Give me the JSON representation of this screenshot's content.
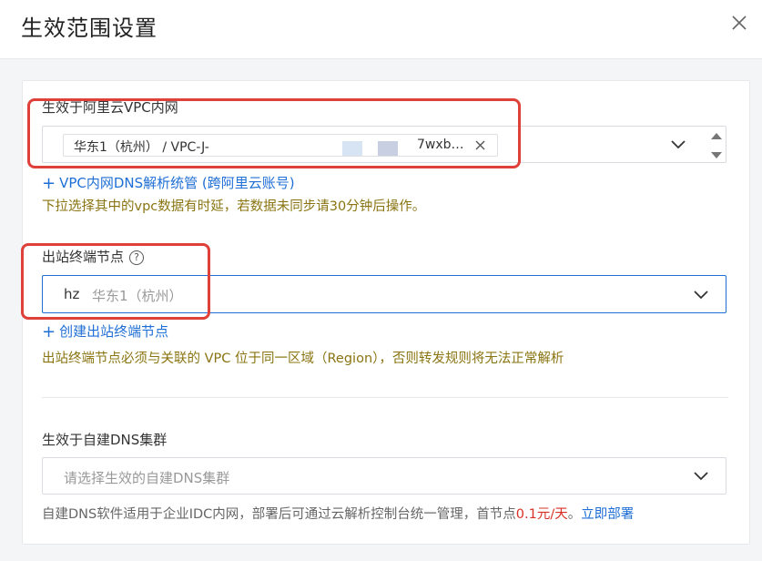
{
  "dialog": {
    "title": "生效范围设置"
  },
  "vpc_section": {
    "label": "生效于阿里云VPC内网",
    "tag_prefix": "华东1（杭州） / VPC-J-",
    "tag_suffix": "7wxb…",
    "link_label": "VPC内网DNS解析统管 (跨阿里云账号)",
    "hint": "下拉选择其中的vpc数据有时延，若数据未同步请30分钟后操作。"
  },
  "outbound_section": {
    "label": "出站终端节点",
    "help_icon": "?",
    "selected_value": "hz",
    "selected_region": "华东1（杭州）",
    "link_label": "创建出站终端节点",
    "hint": "出站终端节点必须与关联的 VPC 位于同一区域（Region），否则转发规则将无法正常解析"
  },
  "dns_cluster_section": {
    "label": "生效于自建DNS集群",
    "placeholder": "请选择生效的自建DNS集群",
    "desc_prefix": "自建DNS软件适用于企业IDC内网，部署后可通过云解析控制台统一管理，首节点",
    "price": "0.1元/天",
    "desc_sep": "。",
    "deploy_link": "立即部署"
  },
  "colors": {
    "accent": "#1f6fd6",
    "hint": "#8a7412",
    "price": "#d93026",
    "highlight_box": "#e0403a",
    "active_border": "#1f6fd6"
  },
  "icons": {
    "close": "close-icon",
    "chevron": "chevron-down-icon",
    "help": "help-circle-icon",
    "plus": "plus-icon",
    "tag_close": "tag-close-icon",
    "stepper": "stepper-icon"
  }
}
